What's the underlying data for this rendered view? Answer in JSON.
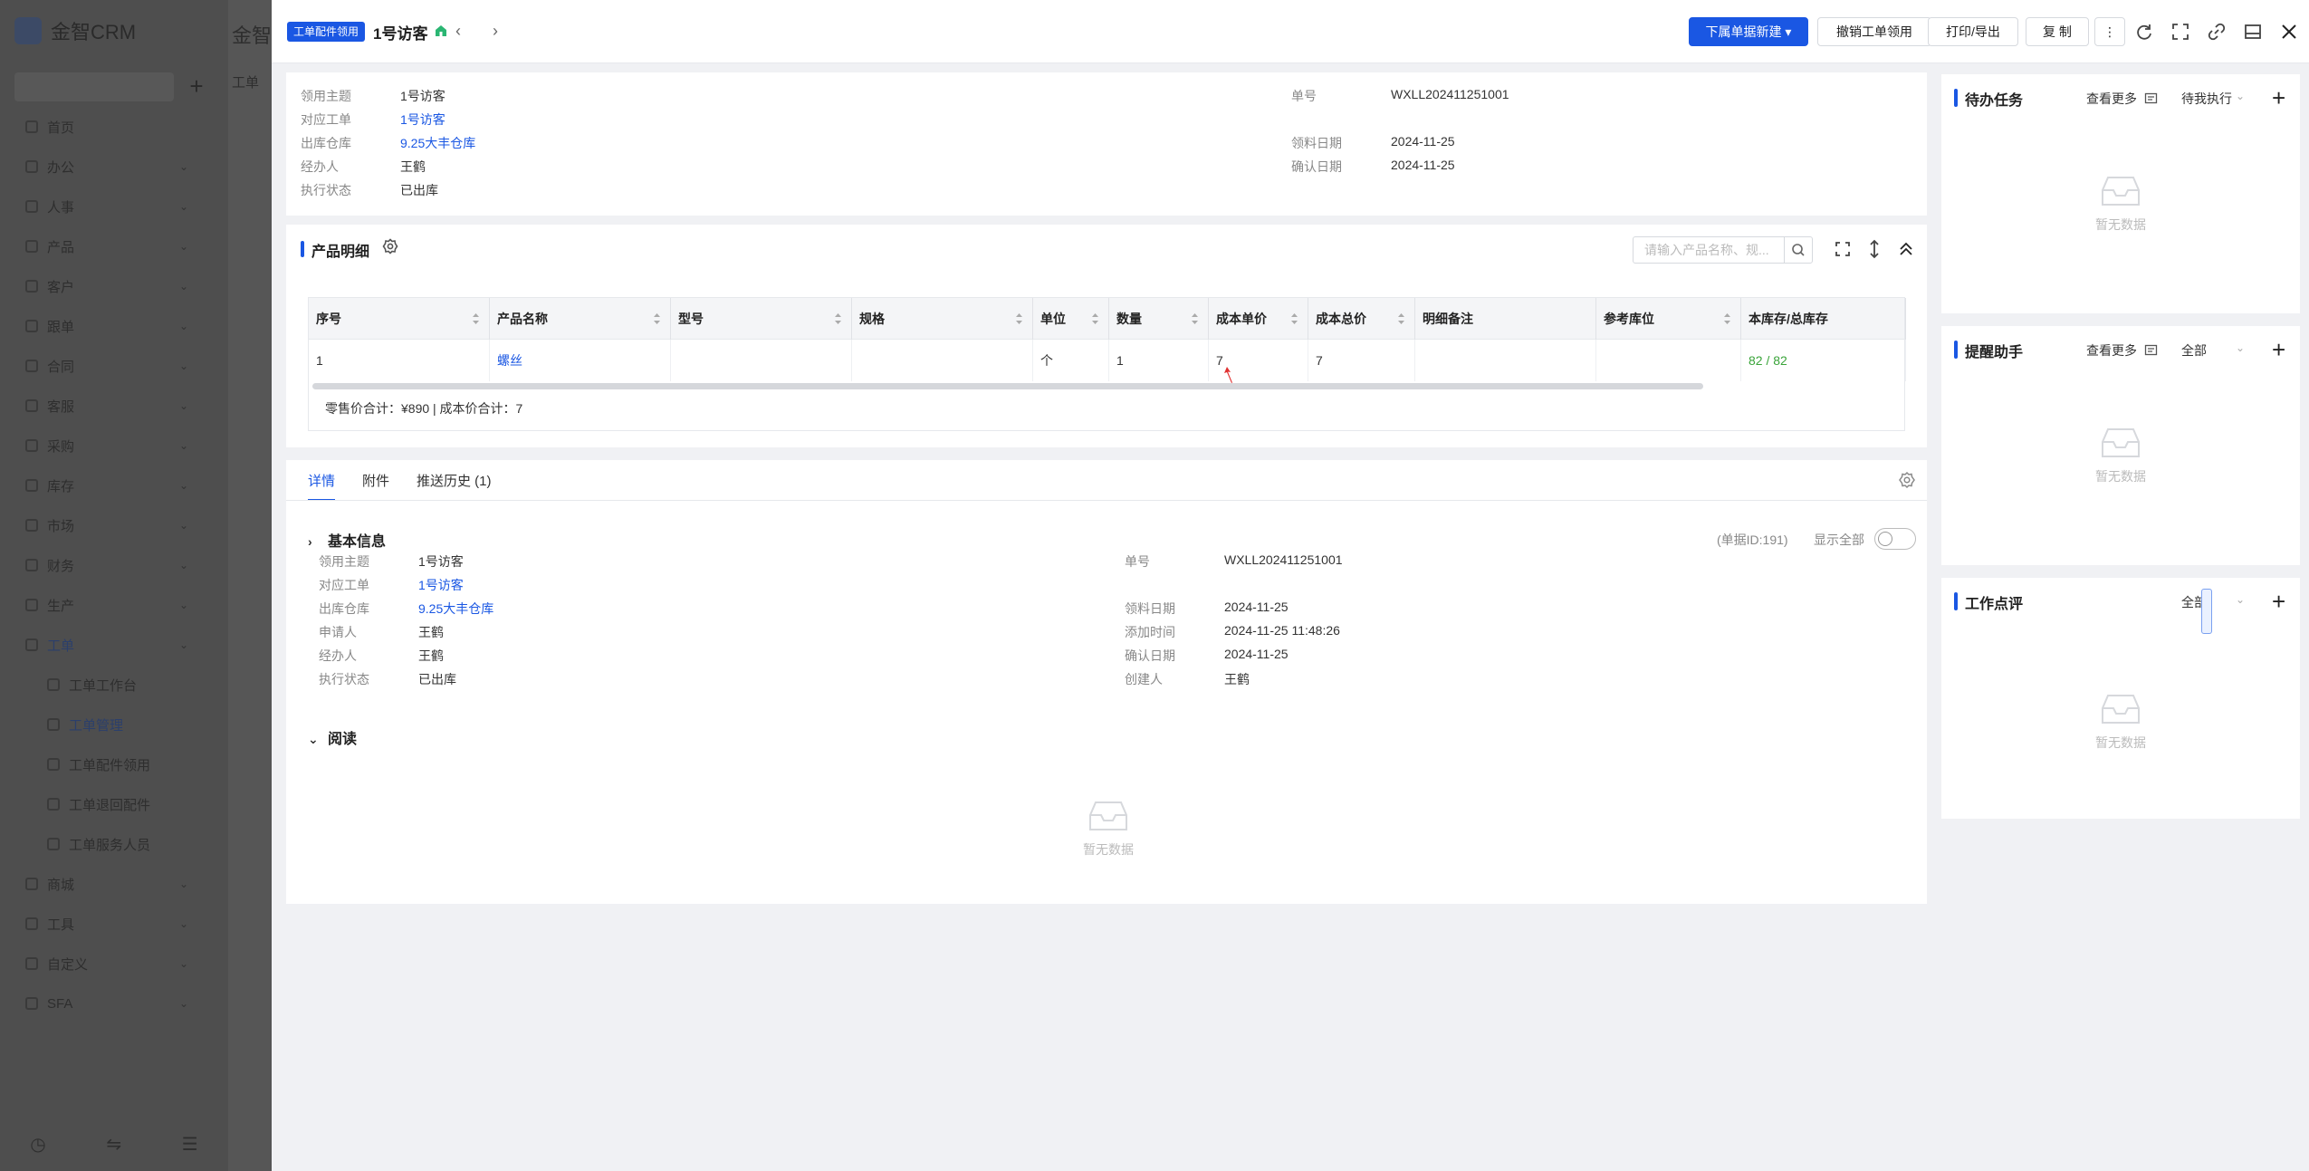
{
  "background_app": {
    "logo_text": "金智CRM",
    "menu": [
      {
        "label": "首页",
        "has_caret": false
      },
      {
        "label": "办公",
        "has_caret": true
      },
      {
        "label": "人事",
        "has_caret": true
      },
      {
        "label": "产品",
        "has_caret": true
      },
      {
        "label": "客户",
        "has_caret": true
      },
      {
        "label": "跟单",
        "has_caret": true
      },
      {
        "label": "合同",
        "has_caret": true
      },
      {
        "label": "客服",
        "has_caret": true
      },
      {
        "label": "采购",
        "has_caret": true
      },
      {
        "label": "库存",
        "has_caret": true
      },
      {
        "label": "市场",
        "has_caret": true
      },
      {
        "label": "财务",
        "has_caret": true
      },
      {
        "label": "生产",
        "has_caret": true
      },
      {
        "label": "工单",
        "has_caret": true,
        "expanded": true
      }
    ],
    "submenu": [
      "工单工作台",
      "工单管理",
      "工单配件领用",
      "工单退回配件",
      "工单服务人员"
    ],
    "menu_after": [
      "商城",
      "工具",
      "自定义",
      "SFA"
    ],
    "main_title": "金智",
    "main_subtitle": "工单"
  },
  "header": {
    "badge": "工单配件领用",
    "title": "1号访客",
    "buttons": {
      "new_sub": "下属单据新建",
      "revoke": "撤销工单领用",
      "print": "打印/导出",
      "copy": "复 制"
    }
  },
  "summary": {
    "left": [
      {
        "label": "领用主题",
        "value": "1号访客",
        "link": false
      },
      {
        "label": "对应工单",
        "value": "1号访客",
        "link": true
      },
      {
        "label": "出库仓库",
        "value": "9.25大丰仓库",
        "link": true
      },
      {
        "label": "经办人",
        "value": "王鹤",
        "link": false
      },
      {
        "label": "执行状态",
        "value": "已出库",
        "link": false
      }
    ],
    "right": [
      {
        "label": "单号",
        "value": "WXLL202411251001"
      },
      {
        "label": "领料日期",
        "value": "2024-11-25"
      },
      {
        "label": "确认日期",
        "value": "2024-11-25"
      }
    ]
  },
  "products": {
    "title": "产品明细",
    "search_placeholder": "请输入产品名称、规...",
    "columns": [
      "序号",
      "产品名称",
      "型号",
      "规格",
      "单位",
      "数量",
      "成本单价",
      "成本总价",
      "明细备注",
      "参考库位",
      "本库存/总库存"
    ],
    "rows": [
      {
        "cells": [
          "1",
          "螺丝",
          "",
          "",
          "个",
          "1",
          "7",
          "7",
          "",
          "",
          "82 / 82"
        ]
      }
    ],
    "totals": "零售价合计：¥890 |   成本价合计：7"
  },
  "detail": {
    "tabs": [
      "详情",
      "附件",
      "推送历史 (1)"
    ],
    "basic_title": "基本信息",
    "doc_id": "(单据ID:191)",
    "show_all": "显示全部",
    "left": [
      {
        "label": "领用主题",
        "value": "1号访客",
        "link": false
      },
      {
        "label": "对应工单",
        "value": "1号访客",
        "link": true
      },
      {
        "label": "出库仓库",
        "value": "9.25大丰仓库",
        "link": true
      },
      {
        "label": "申请人",
        "value": "王鹤",
        "link": false
      },
      {
        "label": "经办人",
        "value": "王鹤",
        "link": false
      },
      {
        "label": "执行状态",
        "value": "已出库",
        "link": false
      }
    ],
    "right": [
      {
        "label": "单号",
        "value": "WXLL202411251001"
      },
      {
        "label": "领料日期",
        "value": "2024-11-25"
      },
      {
        "label": "添加时间",
        "value": "2024-11-25 11:48:26"
      },
      {
        "label": "确认日期",
        "value": "2024-11-25"
      },
      {
        "label": "创建人",
        "value": "王鹤"
      }
    ],
    "read_title": "阅读",
    "empty_text": "暂无数据"
  },
  "panels": {
    "todo": {
      "title": "待办任务",
      "more": "查看更多",
      "filter": "待我执行",
      "empty": "暂无数据"
    },
    "reminder": {
      "title": "提醒助手",
      "more": "查看更多",
      "filter": "全部",
      "empty": "暂无数据"
    },
    "review": {
      "title": "工作点评",
      "filter": "全部",
      "empty": "暂无数据"
    }
  }
}
